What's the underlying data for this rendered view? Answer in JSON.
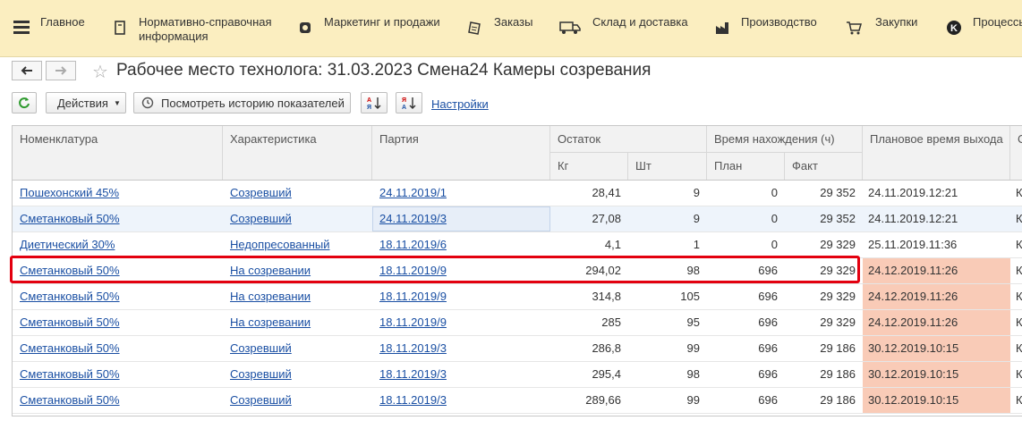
{
  "menu": [
    {
      "label": "Главное",
      "icon": "menu-icon"
    },
    {
      "label": "Нормативно-справочная информация",
      "line1": "Нормативно-справочная",
      "line2": "информация",
      "icon": "book-icon"
    },
    {
      "label": "Маркетинг и продажи",
      "icon": "marketing-icon"
    },
    {
      "label": "Заказы",
      "icon": "orders-icon"
    },
    {
      "label": "Склад и доставка",
      "icon": "truck-icon"
    },
    {
      "label": "Производство",
      "icon": "factory-icon"
    },
    {
      "label": "Закупки",
      "icon": "cart-icon"
    },
    {
      "label": "Процессы",
      "icon": "processes-icon"
    }
  ],
  "title": "Рабочее место технолога: 31.03.2023 Смена24 Камеры созревания",
  "toolbar": {
    "actions_label": "Действия",
    "history_label": "Посмотреть историю показателей",
    "settings_label": "Настройки"
  },
  "table": {
    "headers": {
      "nomenclature": "Номенклатура",
      "characteristic": "Характеристика",
      "batch": "Партия",
      "remainder": "Остаток",
      "kg": "Кг",
      "pcs": "Шт",
      "time": "Время нахождения (ч)",
      "plan": "План",
      "fact": "Факт",
      "planned_exit": "Плановое время выхода",
      "extra": "С"
    },
    "rows": [
      {
        "nom": "Пошехонский 45%",
        "char": "Созревший",
        "batch": "24.11.2019/1",
        "kg": "28,41",
        "pcs": "9",
        "plan": "0",
        "fact": "29 352",
        "exit": "24.11.2019.12:21",
        "extra": "К",
        "hl": false
      },
      {
        "nom": "Сметанковый 50%",
        "char": "Созревший",
        "batch": "24.11.2019/3",
        "kg": "27,08",
        "pcs": "9",
        "plan": "0",
        "fact": "29 352",
        "exit": "24.11.2019.12:21",
        "extra": "К",
        "hl": false
      },
      {
        "nom": "Диетический 30%",
        "char": "Недопресованный",
        "batch": "18.11.2019/6",
        "kg": "4,1",
        "pcs": "1",
        "plan": "0",
        "fact": "29 329",
        "exit": "25.11.2019.11:36",
        "extra": "К",
        "hl": false
      },
      {
        "nom": "Сметанковый 50%",
        "char": "На созревании",
        "batch": "18.11.2019/9",
        "kg": "294,02",
        "pcs": "98",
        "plan": "696",
        "fact": "29 329",
        "exit": "24.12.2019.11:26",
        "extra": "К",
        "hl": true
      },
      {
        "nom": "Сметанковый 50%",
        "char": "На созревании",
        "batch": "18.11.2019/9",
        "kg": "314,8",
        "pcs": "105",
        "plan": "696",
        "fact": "29 329",
        "exit": "24.12.2019.11:26",
        "extra": "К",
        "hl": true
      },
      {
        "nom": "Сметанковый 50%",
        "char": "На созревании",
        "batch": "18.11.2019/9",
        "kg": "285",
        "pcs": "95",
        "plan": "696",
        "fact": "29 329",
        "exit": "24.12.2019.11:26",
        "extra": "К",
        "hl": true
      },
      {
        "nom": "Сметанковый 50%",
        "char": "Созревший",
        "batch": "18.11.2019/3",
        "kg": "286,8",
        "pcs": "99",
        "plan": "696",
        "fact": "29 186",
        "exit": "30.12.2019.10:15",
        "extra": "К",
        "hl": true
      },
      {
        "nom": "Сметанковый 50%",
        "char": "Созревший",
        "batch": "18.11.2019/3",
        "kg": "295,4",
        "pcs": "98",
        "plan": "696",
        "fact": "29 186",
        "exit": "30.12.2019.10:15",
        "extra": "К",
        "hl": true
      },
      {
        "nom": "Сметанковый 50%",
        "char": "Созревший",
        "batch": "18.11.2019/3",
        "kg": "289,66",
        "pcs": "99",
        "plan": "696",
        "fact": "29 186",
        "exit": "30.12.2019.10:15",
        "extra": "К",
        "hl": true
      }
    ]
  },
  "colors": {
    "topbar": "#fbeec0",
    "highlight": "#f9cbb7",
    "selection_frame": "#e3000f",
    "link": "#1a4fa3"
  }
}
